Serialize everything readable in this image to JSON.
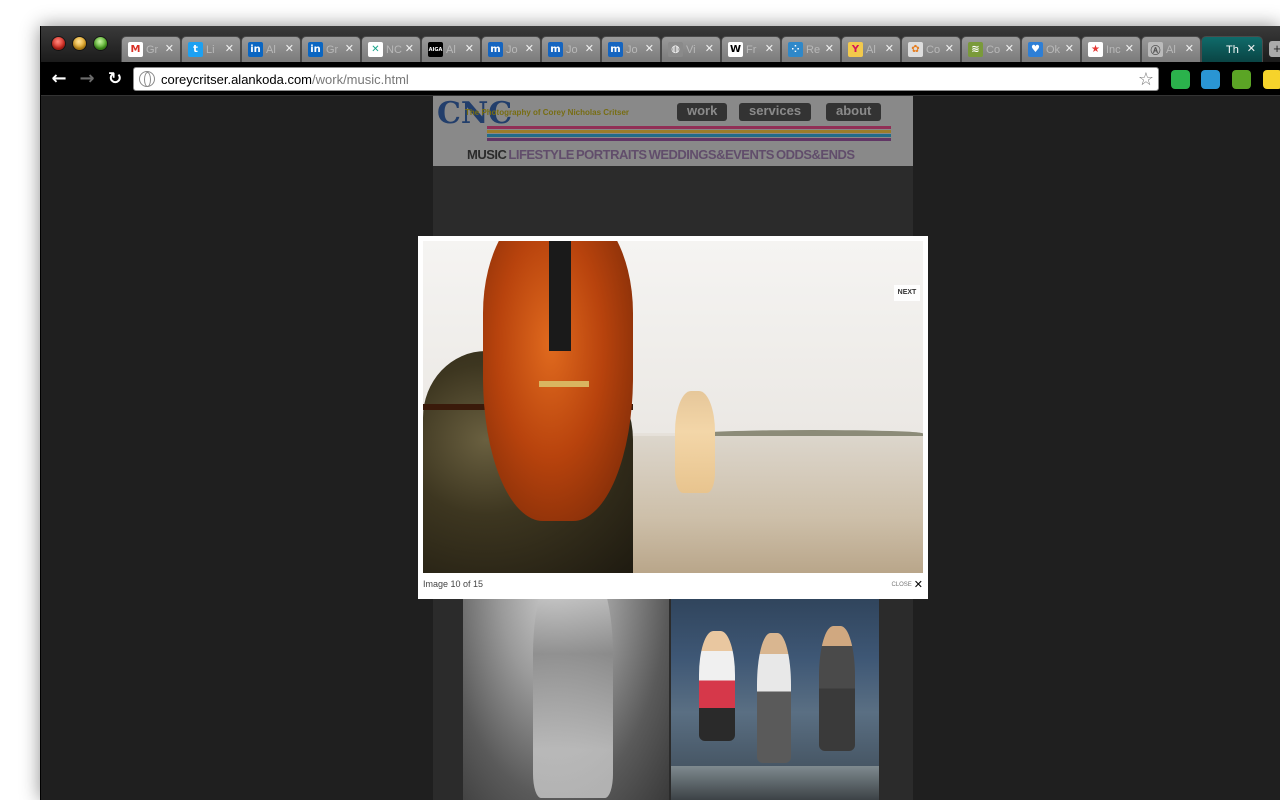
{
  "browser": {
    "address": {
      "domain": "coreycritser.alankoda.com",
      "path": "/work/music.html"
    },
    "tabs": [
      {
        "label": "Gr",
        "icon": "gmail-icon",
        "color": "#ffffff",
        "glyph": "M",
        "glyph_color": "#d93025"
      },
      {
        "label": "Li",
        "icon": "twitter-icon",
        "color": "#1da1f2",
        "glyph": "t",
        "glyph_color": "#ffffff"
      },
      {
        "label": "Al",
        "icon": "linkedin-icon",
        "color": "#0a66c2",
        "glyph": "in",
        "glyph_color": "#ffffff"
      },
      {
        "label": "Gr",
        "icon": "linkedin-icon",
        "color": "#0a66c2",
        "glyph": "in",
        "glyph_color": "#ffffff"
      },
      {
        "label": "NC",
        "icon": "x-logo-icon",
        "color": "#ffffff",
        "glyph": "✕",
        "glyph_color": "#1aa58a"
      },
      {
        "label": "Al",
        "icon": "aiga-icon",
        "color": "#000000",
        "glyph": "AIGA",
        "glyph_color": "#ffffff"
      },
      {
        "label": "Jo",
        "icon": "monster-icon",
        "color": "#1565c0",
        "glyph": "m",
        "glyph_color": "#ffffff"
      },
      {
        "label": "Jo",
        "icon": "monster-icon",
        "color": "#1565c0",
        "glyph": "m",
        "glyph_color": "#ffffff"
      },
      {
        "label": "Jo",
        "icon": "monster-icon",
        "color": "#1565c0",
        "glyph": "m",
        "glyph_color": "#ffffff"
      },
      {
        "label": "Vi",
        "icon": "globe-icon",
        "color": "#8a8a8a",
        "glyph": "◍",
        "glyph_color": "#ffffff"
      },
      {
        "label": "Fr",
        "icon": "wikipedia-icon",
        "color": "#ffffff",
        "glyph": "W",
        "glyph_color": "#000000"
      },
      {
        "label": "Re",
        "icon": "dots-icon",
        "color": "#2f88c9",
        "glyph": "⁘",
        "glyph_color": "#ffffff"
      },
      {
        "label": "Al",
        "icon": "yahoo-icon",
        "color": "#f2c94c",
        "glyph": "Y",
        "glyph_color": "#d4145a"
      },
      {
        "label": "Co",
        "icon": "nbc-icon",
        "color": "#dddddd",
        "glyph": "✿",
        "glyph_color": "#e57c1e"
      },
      {
        "label": "Co",
        "icon": "lizard-icon",
        "color": "#7a9a3a",
        "glyph": "≋",
        "glyph_color": "#ffffff"
      },
      {
        "label": "Ok",
        "icon": "heart-icon",
        "color": "#2e7fd6",
        "glyph": "♥",
        "glyph_color": "#ffffff"
      },
      {
        "label": "Inc",
        "icon": "star-icon",
        "color": "#ffffff",
        "glyph": "★",
        "glyph_color": "#e53935"
      },
      {
        "label": "Al",
        "icon": "circle-logo-icon",
        "color": "#bbbbbb",
        "glyph": "Ⓐ",
        "glyph_color": "#555555"
      },
      {
        "label": "Th",
        "icon": "none",
        "color": "",
        "glyph": "",
        "glyph_color": "",
        "active": true
      }
    ],
    "extensions": [
      {
        "icon": "feedly-icon",
        "color": "#2bb24c"
      },
      {
        "icon": "tweetdeck-icon",
        "color": "#2a95d3"
      },
      {
        "icon": "evernote-icon",
        "color": "#5ba525"
      },
      {
        "icon": "bookmark-star-icon",
        "color": "#f6d32b"
      }
    ]
  },
  "site": {
    "logo": "CNC",
    "tagline": "The Photography of Corey Nicholas Critser",
    "nav": [
      "work",
      "services",
      "about"
    ],
    "categories": [
      "MUSIC",
      "LIFESTYLE",
      "PORTRAITS",
      "WEDDINGS&EVENTS",
      "ODDS&ENDS"
    ],
    "stripe_colors": [
      "#e6337a",
      "#f7c12a",
      "#19a2d6",
      "#8e3f96"
    ]
  },
  "lightbox": {
    "next_label": "NEXT",
    "caption": "Image 10 of 15",
    "close_label": "CLOSE"
  }
}
